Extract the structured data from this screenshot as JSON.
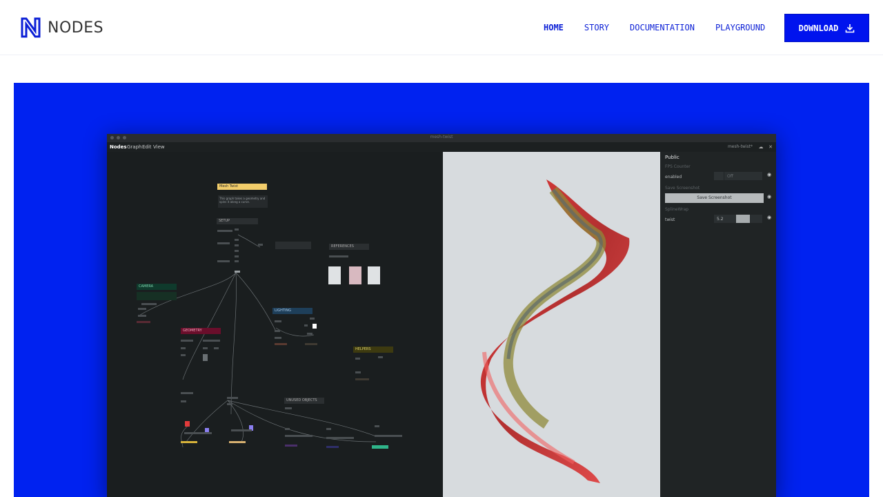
{
  "brand": {
    "name": "NODES"
  },
  "nav": {
    "home": "HOME",
    "story": "STORY",
    "documentation": "DOCUMENTATION",
    "playground": "PLAYGROUND",
    "download": "DOWNLOAD"
  },
  "colors": {
    "accent": "#0013ee",
    "hero_bg": "#0022f0",
    "logo": "#0b1fd6"
  },
  "app": {
    "window_title": "mesh-twist",
    "menu": {
      "brand": "Nodes",
      "graph": "Graph",
      "edit": "Edit",
      "view": "View"
    },
    "file_name": "mesh-twist*",
    "graph": {
      "main_title": "Mesh Twist",
      "main_desc": "This graph takes a geometry and spins it along a curve.",
      "setup": "SETUP",
      "references": "REFERENCES",
      "camera": "CAMERA",
      "lighting": "LIGHTING",
      "geometry": "GEOMETRY",
      "helpers": "HELPERS",
      "unused_objects": "UNUSED OBJECTS"
    },
    "panel": {
      "title": "Public",
      "fps_section": "FPS Counter",
      "fps_label": "enabled",
      "fps_value": "Off",
      "screenshot_section": "Save Screenshot",
      "screenshot_button": "Save Screenshot",
      "spline_section": "SplineWrap",
      "twist_label": "twist",
      "twist_value": "5.2"
    },
    "icons": [
      "cloud-icon",
      "fullscreen-icon",
      "eye-icon",
      "download-icon"
    ]
  }
}
